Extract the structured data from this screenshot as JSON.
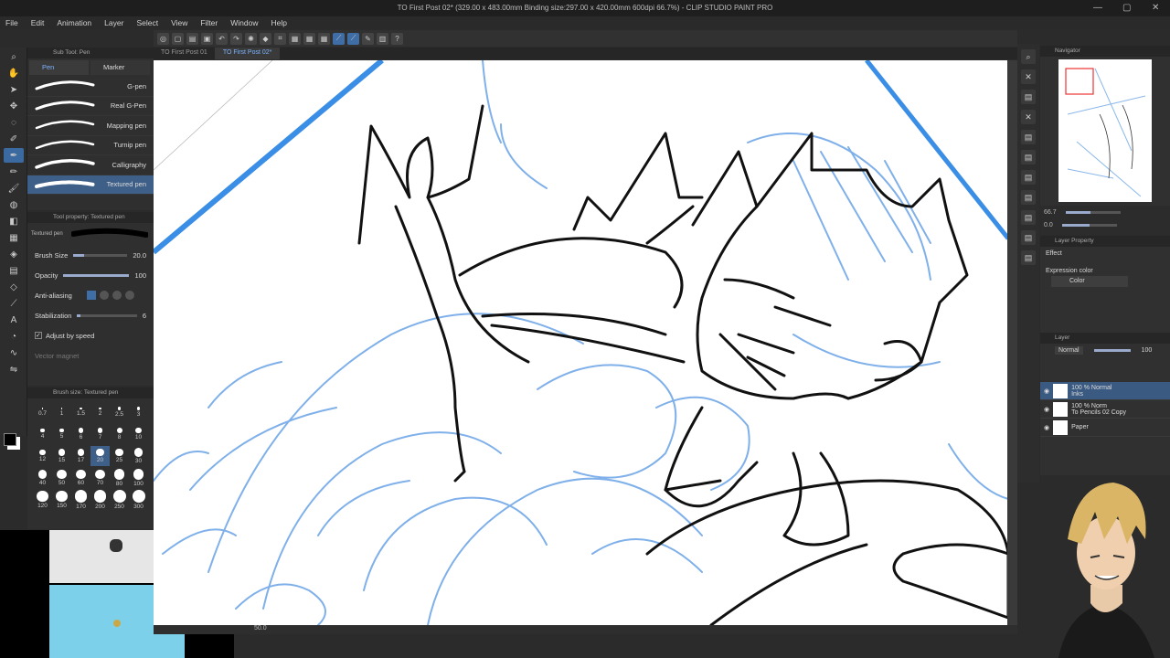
{
  "window": {
    "title": "TO First Post 02* (329.00 x 483.00mm Binding size:297.00 x 420.00mm 600dpi 66.7%) - CLIP STUDIO PAINT PRO",
    "minimize": "—",
    "maximize": "▢",
    "close": "✕"
  },
  "menu": [
    "File",
    "Edit",
    "Animation",
    "Layer",
    "Select",
    "View",
    "Filter",
    "Window",
    "Help"
  ],
  "tabs": [
    {
      "label": "TO First Post 01",
      "active": false
    },
    {
      "label": "TO First Post 02*",
      "active": true
    }
  ],
  "subtool": {
    "panel_title": "Sub Tool: Pen",
    "tabs": [
      "Pen",
      "Marker"
    ],
    "brushes": [
      "G-pen",
      "Real G-Pen",
      "Mapping pen",
      "Turnip pen",
      "Calligraphy",
      "Textured pen"
    ]
  },
  "tool_property": {
    "panel_title": "Tool property: Textured pen",
    "preset_label": "Textured pen",
    "brush_size_label": "Brush Size",
    "brush_size_value": "20.0",
    "opacity_label": "Opacity",
    "opacity_value": "100",
    "antialias_label": "Anti-aliasing",
    "stabilization_label": "Stabilization",
    "stabilization_value": "6",
    "adjust_label": "Adjust by speed",
    "vector_label": "Vector magnet"
  },
  "brush_size_panel": {
    "title": "Brush size: Textured pen",
    "sizes": [
      "0.7",
      "1",
      "1.5",
      "2",
      "2.5",
      "3",
      "4",
      "5",
      "6",
      "7",
      "8",
      "10",
      "12",
      "15",
      "17",
      "20",
      "25",
      "30",
      "40",
      "50",
      "60",
      "70",
      "80",
      "100",
      "120",
      "150",
      "170",
      "200",
      "250",
      "300"
    ],
    "selected": "20"
  },
  "navigator": {
    "title": "Navigator",
    "zoom": "66.7",
    "angle": "0.0"
  },
  "layer_property": {
    "title": "Layer Property",
    "effect_label": "Effect",
    "expression_label": "Expression color",
    "expression_value": "Color"
  },
  "layers": {
    "title": "Layer",
    "blend_mode": "Normal",
    "opacity": "100",
    "items": [
      {
        "name": "Inks",
        "mode": "100 % Normal",
        "selected": true
      },
      {
        "name": "To Pencils 02 Copy",
        "mode": "100 % Norm",
        "selected": false
      },
      {
        "name": "Paper",
        "mode": "",
        "selected": false
      }
    ]
  },
  "status": {
    "zoom": "50.0"
  },
  "colors": {
    "accent": "#3e6ea5",
    "sketch_blue": "#7fb0ea",
    "ink": "#111111"
  }
}
